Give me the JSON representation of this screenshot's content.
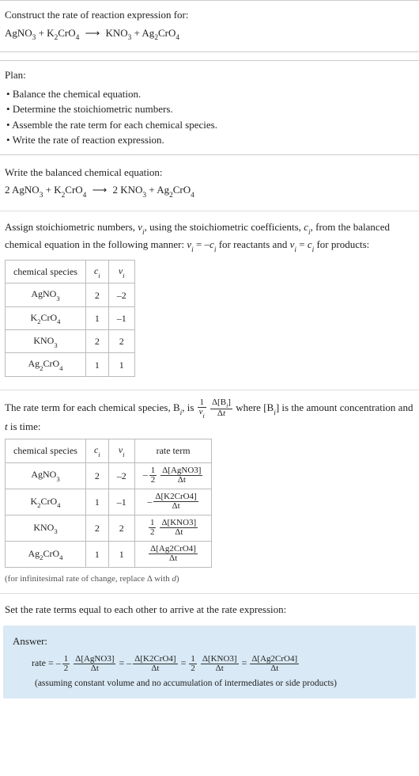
{
  "sec1": {
    "heading": "Construct the rate of reaction expression for:",
    "eq_html": "AgNO<sub>3</sub> + K<sub>2</sub>CrO<sub>4</sub> <span class='arrow'>⟶</span> KNO<sub>3</sub> + Ag<sub>2</sub>CrO<sub>4</sub>"
  },
  "sec2": {
    "heading": "Plan:",
    "b1": "Balance the chemical equation.",
    "b2": "Determine the stoichiometric numbers.",
    "b3": "Assemble the rate term for each chemical species.",
    "b4": "Write the rate of reaction expression."
  },
  "sec3": {
    "heading": "Write the balanced chemical equation:",
    "eq_html": "2 AgNO<sub>3</sub> + K<sub>2</sub>CrO<sub>4</sub> <span class='arrow'>⟶</span> 2 KNO<sub>3</sub> + Ag<sub>2</sub>CrO<sub>4</sub>"
  },
  "sec4": {
    "text1_html": "Assign stoichiometric numbers, <span class='ital'>ν<sub>i</sub></span>, using the stoichiometric coefficients, <span class='ital'>c<sub>i</sub></span>, from the balanced chemical equation in the following manner: <span class='ital'>ν<sub>i</sub></span> = –<span class='ital'>c<sub>i</sub></span> for reactants and <span class='ital'>ν<sub>i</sub></span> = <span class='ital'>c<sub>i</sub></span> for products:"
  },
  "table1": {
    "h1": "chemical species",
    "h2_html": "<span class='ital'>c<sub>i</sub></span>",
    "h3_html": "<span class='ital'>ν<sub>i</sub></span>",
    "rows": [
      {
        "sp_html": "AgNO<sub>3</sub>",
        "c": "2",
        "v": "–2"
      },
      {
        "sp_html": "K<sub>2</sub>CrO<sub>4</sub>",
        "c": "1",
        "v": "–1"
      },
      {
        "sp_html": "KNO<sub>3</sub>",
        "c": "2",
        "v": "2"
      },
      {
        "sp_html": "Ag<sub>2</sub>CrO<sub>4</sub>",
        "c": "1",
        "v": "1"
      }
    ]
  },
  "sec5": {
    "pre_html": "The rate term for each chemical species, B<sub><i>i</i></sub>, is ",
    "frac1_num_html": "1",
    "frac1_den_html": "<span class='ital'>ν<sub>i</sub></span>",
    "frac2_num_html": "Δ[B<sub><i>i</i></sub>]",
    "frac2_den_html": "Δ<i>t</i>",
    "post_html": " where [B<sub><i>i</i></sub>] is the amount concentration and <i>t</i> is time:"
  },
  "table2": {
    "h1": "chemical species",
    "h2_html": "<span class='ital'>c<sub>i</sub></span>",
    "h3_html": "<span class='ital'>ν<sub>i</sub></span>",
    "h4": "rate term",
    "rows": [
      {
        "sp_html": "AgNO<sub>3</sub>",
        "c": "2",
        "v": "–2",
        "term": {
          "neg": true,
          "coef_num": "1",
          "coef_den": "2",
          "main_num": "Δ[AgNO3]",
          "main_den": "Δt"
        }
      },
      {
        "sp_html": "K<sub>2</sub>CrO<sub>4</sub>",
        "c": "1",
        "v": "–1",
        "term": {
          "neg": true,
          "main_num": "Δ[K2CrO4]",
          "main_den": "Δt"
        }
      },
      {
        "sp_html": "KNO<sub>3</sub>",
        "c": "2",
        "v": "2",
        "term": {
          "neg": false,
          "coef_num": "1",
          "coef_den": "2",
          "main_num": "Δ[KNO3]",
          "main_den": "Δt"
        }
      },
      {
        "sp_html": "Ag<sub>2</sub>CrO<sub>4</sub>",
        "c": "1",
        "v": "1",
        "term": {
          "neg": false,
          "main_num": "Δ[Ag2CrO4]",
          "main_den": "Δt"
        }
      }
    ],
    "caption_html": "(for infinitesimal rate of change, replace Δ with <i>d</i>)"
  },
  "sec6": {
    "heading": "Set the rate terms equal to each other to arrive at the rate expression:"
  },
  "answer": {
    "title": "Answer:",
    "lead": "rate = ",
    "parts": [
      {
        "neg": true,
        "coef_num": "1",
        "coef_den": "2",
        "num": "Δ[AgNO3]",
        "den": "Δt"
      },
      {
        "neg": true,
        "num": "Δ[K2CrO4]",
        "den": "Δt"
      },
      {
        "neg": false,
        "coef_num": "1",
        "coef_den": "2",
        "num": "Δ[KNO3]",
        "den": "Δt"
      },
      {
        "neg": false,
        "num": "Δ[Ag2CrO4]",
        "den": "Δt"
      }
    ],
    "note": "(assuming constant volume and no accumulation of intermediates or side products)"
  }
}
